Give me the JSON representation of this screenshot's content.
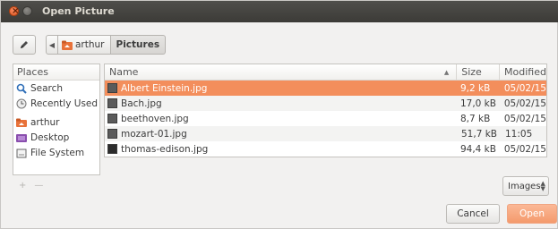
{
  "window": {
    "title": "Open Picture"
  },
  "pathbar": {
    "home_label": "arthur",
    "current_label": "Pictures"
  },
  "places": {
    "header": "Places",
    "items": [
      {
        "label": "Search",
        "icon": "search-icon"
      },
      {
        "label": "Recently Used",
        "icon": "clock-icon"
      },
      {
        "label": "arthur",
        "icon": "home-folder-icon"
      },
      {
        "label": "Desktop",
        "icon": "desktop-icon"
      },
      {
        "label": "File System",
        "icon": "drive-icon"
      }
    ],
    "add_symbol": "+",
    "remove_symbol": "—"
  },
  "files": {
    "columns": {
      "name": "Name",
      "size": "Size",
      "modified": "Modified"
    },
    "rows": [
      {
        "name": "Albert Einstein.jpg",
        "size": "9,2 kB",
        "modified": "05/02/15",
        "selected": true
      },
      {
        "name": "Bach.jpg",
        "size": "17,0 kB",
        "modified": "05/02/15",
        "selected": false
      },
      {
        "name": "beethoven.jpg",
        "size": "8,7 kB",
        "modified": "05/02/15",
        "selected": false
      },
      {
        "name": "mozart-01.jpg",
        "size": "51,7 kB",
        "modified": "11:05",
        "selected": false
      },
      {
        "name": "thomas-edison.jpg",
        "size": "94,4 kB",
        "modified": "05/02/15",
        "selected": false
      }
    ]
  },
  "filter": {
    "selected": "Images"
  },
  "buttons": {
    "cancel": "Cancel",
    "open": "Open"
  },
  "colors": {
    "accent": "#f38e5c",
    "titlebar": "#3c3b37"
  }
}
